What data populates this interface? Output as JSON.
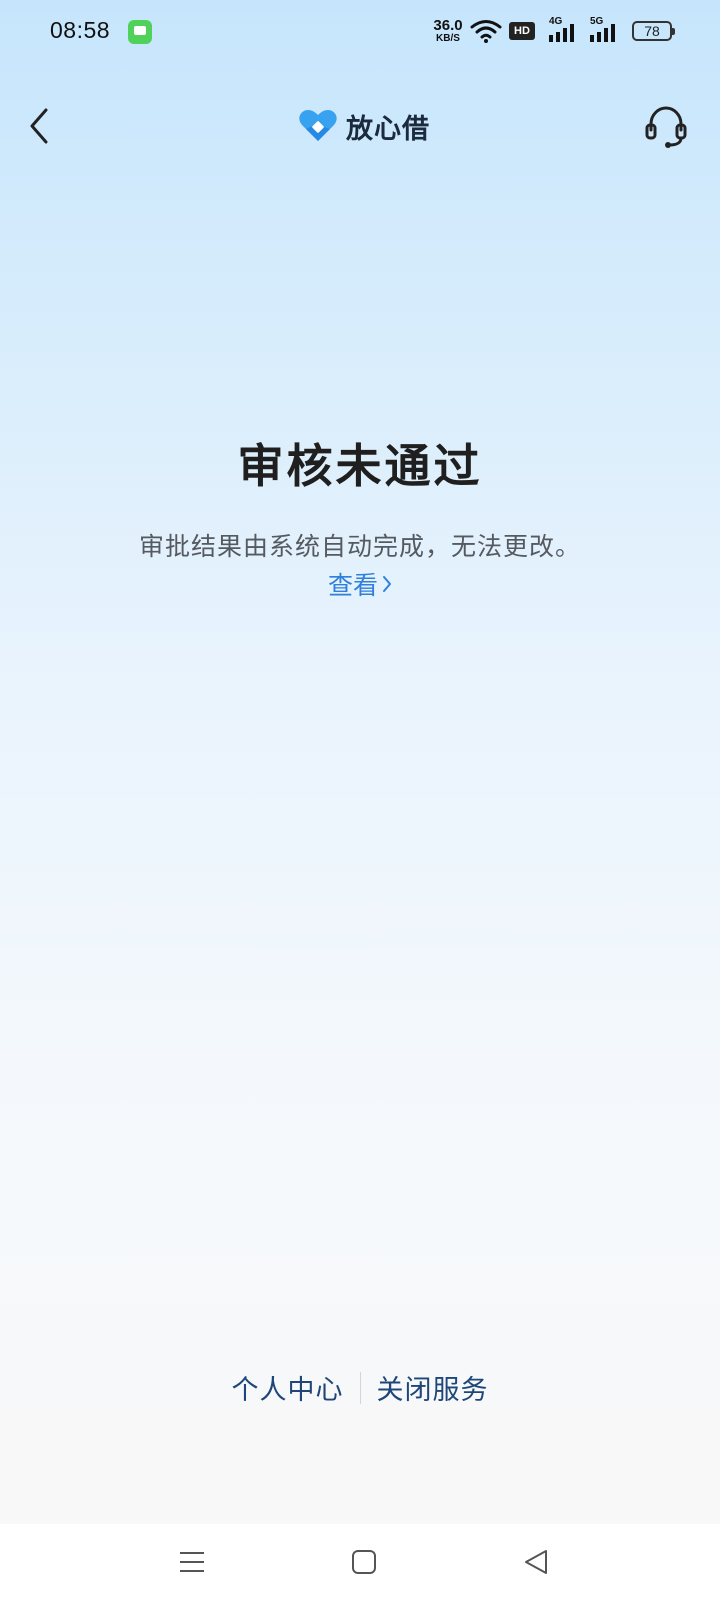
{
  "status_bar": {
    "time": "08:58",
    "net_speed_value": "36.0",
    "net_speed_unit": "KB/S",
    "hd_label": "HD",
    "signal_1_label": "4G",
    "signal_2_label": "5G",
    "battery": "78"
  },
  "header": {
    "brand_name": "放心借",
    "accent_color": "#2f8ff0"
  },
  "main": {
    "title": "审核未通过",
    "description": "审批结果由系统自动完成，无法更改。",
    "view_link": "查看"
  },
  "footer": {
    "personal_center": "个人中心",
    "close_service": "关闭服务"
  },
  "nav_bar": {
    "icons": [
      "menu-icon",
      "home-icon",
      "back-triangle-icon"
    ]
  }
}
